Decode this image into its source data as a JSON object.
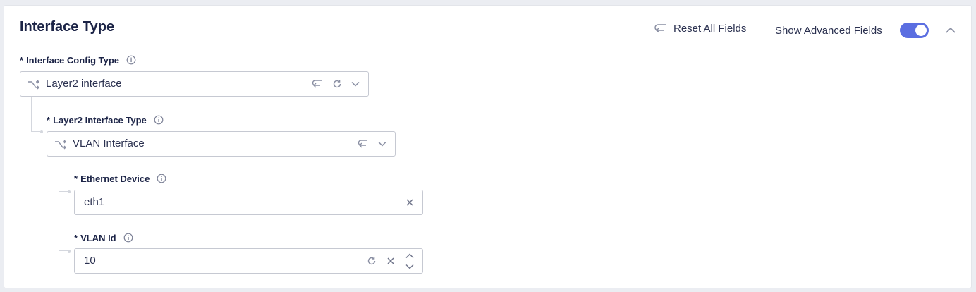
{
  "section": {
    "title": "Interface Type",
    "reset_label": "Reset All Fields",
    "advanced_label": "Show Advanced Fields",
    "advanced_enabled": true
  },
  "fields": {
    "config_type": {
      "required_mark": "*",
      "label": "Interface Config Type",
      "value": "Layer2 interface"
    },
    "l2_type": {
      "required_mark": "*",
      "label": "Layer2 Interface Type",
      "value": "VLAN Interface"
    },
    "ethernet": {
      "required_mark": "*",
      "label": "Ethernet Device",
      "value": "eth1"
    },
    "vlan": {
      "required_mark": "*",
      "label": "VLAN Id",
      "value": "10"
    }
  },
  "icons": {
    "reset": "undo-arrow-icon",
    "info": "info-icon",
    "type": "split-arrows-icon",
    "revert": "undo-arrow-icon",
    "refresh": "refresh-icon",
    "dropdown": "chevron-down-icon",
    "clear": "close-icon",
    "stepper_up": "chevron-up-icon",
    "stepper_down": "chevron-down-icon",
    "collapse": "chevron-up-icon"
  },
  "colors": {
    "accent": "#5b6ee1",
    "text": "#1b2346",
    "border": "#c6c9d2",
    "icon": "#8a8fa3"
  }
}
